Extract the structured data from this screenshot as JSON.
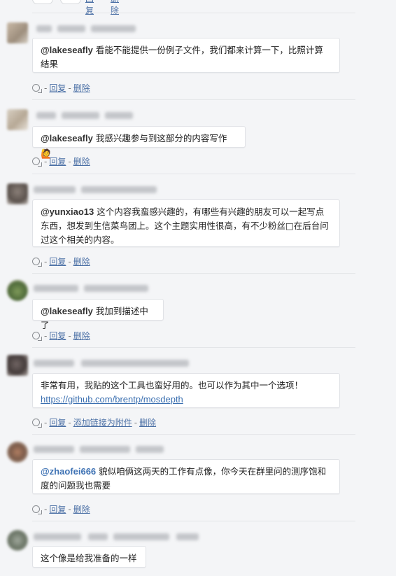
{
  "actions": {
    "reply": "回复",
    "delete": "删除",
    "add_link_attachment": "添加链接为附件"
  },
  "top": {
    "reply": "回复",
    "delete": "删除"
  },
  "comments": [
    {
      "mention": "@lakeseafly",
      "line1": " 看能不能提供一份例子文件，我们都来计算一下，比照计算",
      "line2": "结果"
    },
    {
      "mention": "@lakeseafly",
      "line1": " 我感兴趣参与到这部分的内容写作",
      "emoji": "🙋"
    },
    {
      "mention": "@yunxiao13",
      "line1": " 这个内容我蛮感兴趣的，有哪些有兴趣的朋友可以一起写点",
      "line2": "东西，想发到生信菜鸟团上。这个主题实用性很高，有不少粉丝□在后台问",
      "line3": "过这个相关的内容。"
    },
    {
      "mention": "@lakeseafly",
      "line1": " 我加到描述中了"
    },
    {
      "line1": "非常有用，我贴的这个工具也蛮好用的。也可以作为其中一个选项！",
      "link": "https://github.com/brentp/mosdepth"
    },
    {
      "mention": "@zhaofei666",
      "line1": " 貌似咱俩这两天的工作有点像，你今天在群里问的测序饱和",
      "line2": "度的问题我也需要"
    },
    {
      "line1": "这个像是给我准备的一样"
    }
  ]
}
